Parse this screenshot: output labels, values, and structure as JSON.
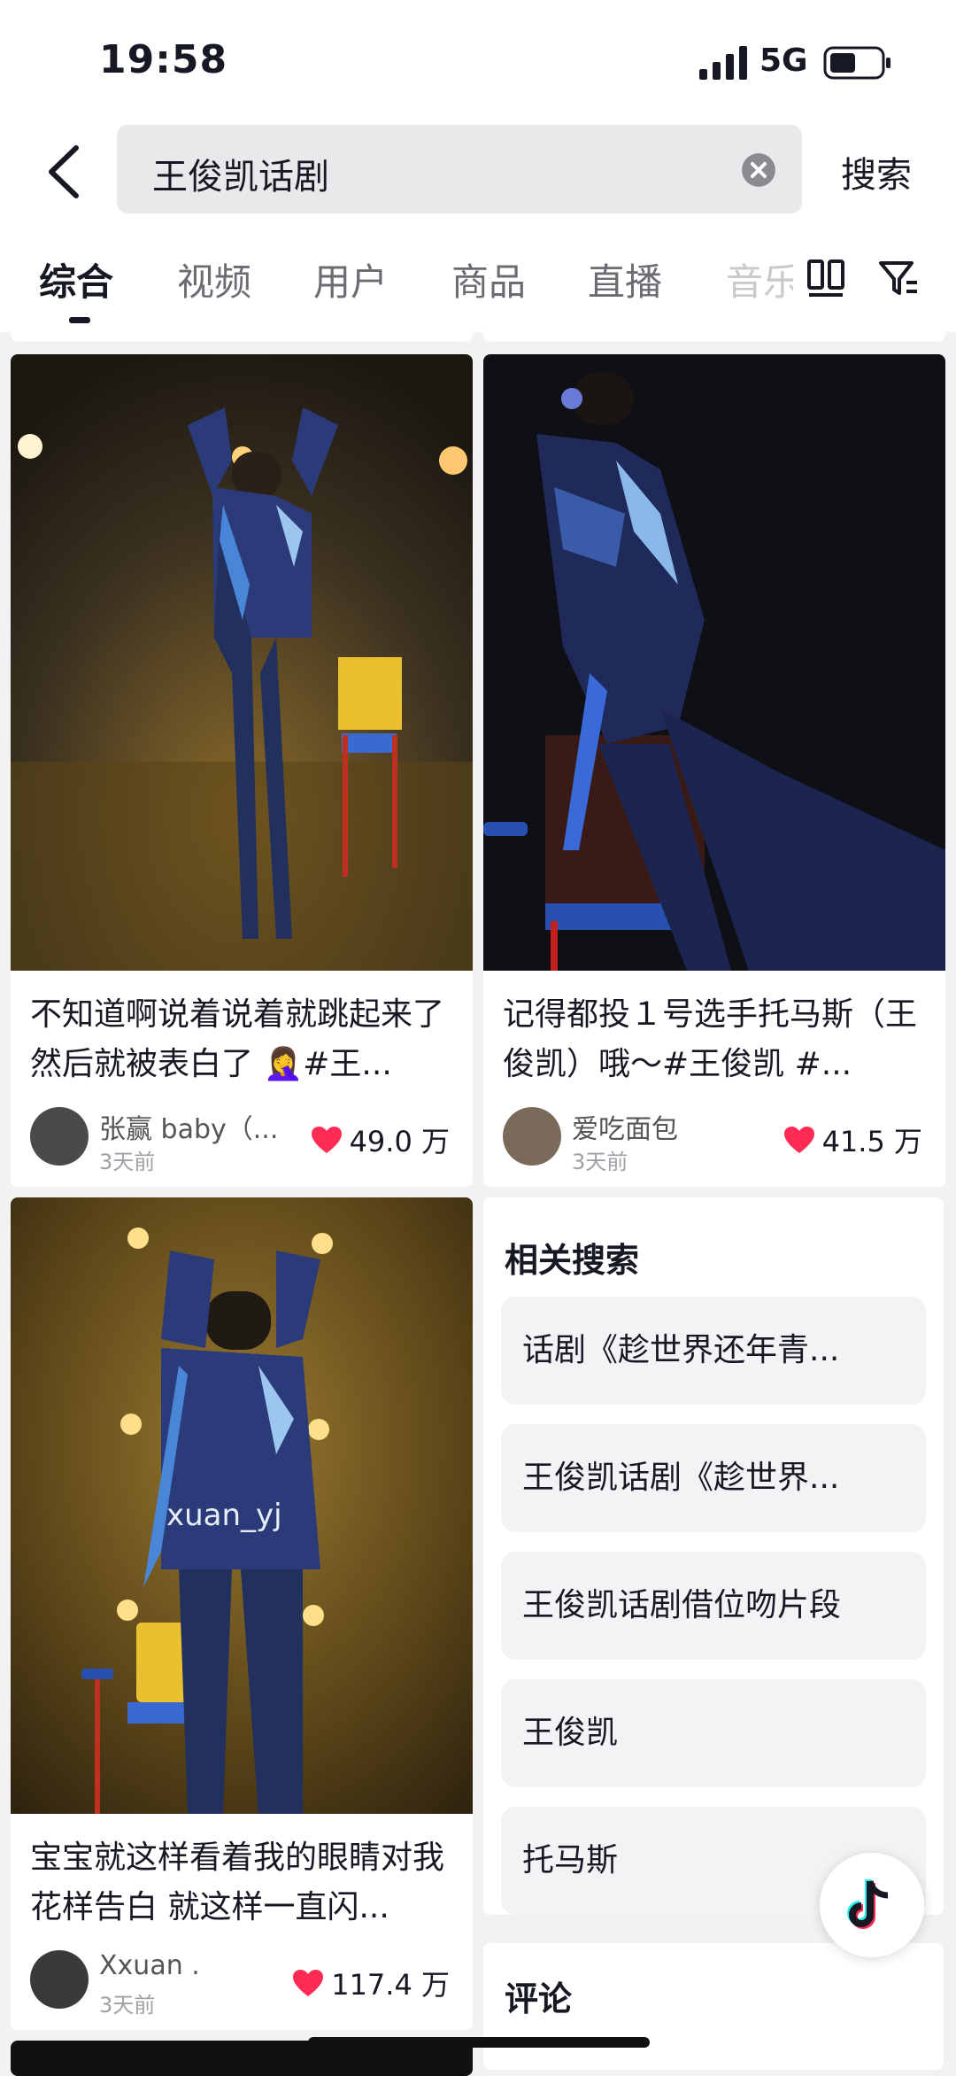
{
  "status": {
    "time": "19:58",
    "network": "5G"
  },
  "search": {
    "query": "王俊凯话剧",
    "button": "搜索"
  },
  "tabs": [
    {
      "label": "综合",
      "active": true
    },
    {
      "label": "视频"
    },
    {
      "label": "用户"
    },
    {
      "label": "商品"
    },
    {
      "label": "直播"
    },
    {
      "label": "音乐"
    }
  ],
  "cards": [
    {
      "title": "不知道啊说着说着就跳起来了然后就被表白了 🤦‍♀️#王...",
      "user": "张赢 baby（...",
      "time": "3天前",
      "likes": "49.0 万"
    },
    {
      "title": "记得都投１号选手托马斯（王俊凯）哦～#王俊凯 #...",
      "user": "爱吃面包",
      "time": "3天前",
      "likes": "41.5 万"
    },
    {
      "title": "宝宝就这样看着我的眼睛对我花样告白 就这样一直闪...",
      "user": "Xxuan .",
      "time": "3天前",
      "likes": "117.4 万",
      "watermark": "xuan_yj"
    }
  ],
  "related": {
    "heading": "相关搜索",
    "items": [
      "话剧《趁世界还年青...",
      "王俊凯话剧《趁世界...",
      "王俊凯话剧借位吻片段",
      "王俊凯",
      "托马斯"
    ]
  },
  "comments": {
    "heading": "评论"
  },
  "colors": {
    "heart": "#fe2c55",
    "tab_active": "#161823",
    "tab_inactive": "#6b6c72"
  }
}
